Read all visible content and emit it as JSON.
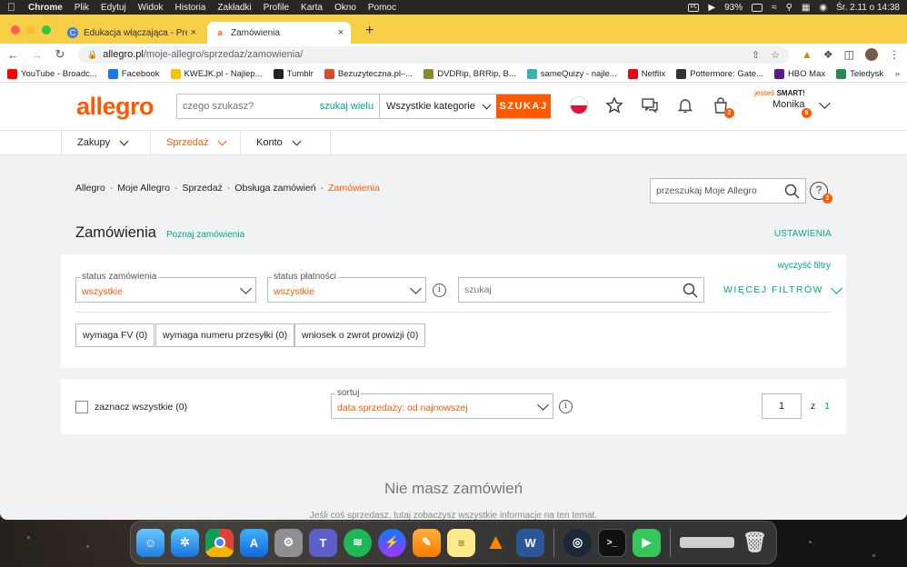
{
  "menubar": {
    "app": "Chrome",
    "items": [
      "Plik",
      "Edytuj",
      "Widok",
      "Historia",
      "Zakładki",
      "Profile",
      "Karta",
      "Okno",
      "Pomoc"
    ],
    "battery": "93%",
    "clock": "Śr. 2.11 o 14:38"
  },
  "browser": {
    "tabs": [
      {
        "title": "Edukacja włączająca - Prezent",
        "active": false
      },
      {
        "title": "Zamówienia",
        "active": true
      }
    ],
    "url_host": "allegro.pl",
    "url_path": "/moje-allegro/sprzedaz/zamowienia/",
    "bookmarks": [
      {
        "label": "YouTube - Broadc...",
        "color": "#ff0000"
      },
      {
        "label": "Facebook",
        "color": "#1877f2"
      },
      {
        "label": "KWEJK.pl - Najlep...",
        "color": "#f5c400"
      },
      {
        "label": "Tumblr",
        "color": "#222222"
      },
      {
        "label": "Bezuzyteczna.pl–...",
        "color": "#d84a2a"
      },
      {
        "label": "DVDRip, BRRip, B...",
        "color": "#8a8a2a"
      },
      {
        "label": "sameQuizy - najle...",
        "color": "#3ab0b0"
      },
      {
        "label": "Netflix",
        "color": "#e50914"
      },
      {
        "label": "Pottermore: Gate...",
        "color": "#333333"
      },
      {
        "label": "HBO Max",
        "color": "#5a1a8a"
      },
      {
        "label": "Teledysk",
        "color": "#2a8a4a"
      }
    ],
    "bookmarks_more": "»"
  },
  "allegro": {
    "logo": "allegro",
    "search_placeholder": "czego szukasz?",
    "search_multi": "szukaj wielu",
    "search_category": "Wszystkie kategorie",
    "search_button": "SZUKAJ",
    "cart_badge": "2",
    "smart_prefix": "jesteś",
    "smart_label": "SMART!",
    "user_name": "Monika",
    "user_badge": "6",
    "nav": [
      "Zakupy",
      "Sprzedaż",
      "Konto"
    ],
    "breadcrumbs": [
      "Allegro",
      "Moje Allegro",
      "Sprzedaż",
      "Obsługa zamówień",
      "Zamówienia"
    ],
    "my_search_placeholder": "przeszukaj Moje Allegro",
    "help_badge": "2",
    "page_title": "Zamówienia",
    "learn_link": "Poznaj zamówienia",
    "settings_link": "USTAWIENIA",
    "clear_filters": "wyczyść filtry",
    "order_status_label": "status zamówienia",
    "order_status_value": "wszystkie",
    "payment_status_label": "status płatności",
    "payment_status_value": "wszystkie",
    "filter_search_placeholder": "szukaj",
    "more_filters": "WIĘCEJ FILTRÓW",
    "chips": [
      "wymaga FV (0)",
      "wymaga numeru przesyłki (0)",
      "wniosek o zwrot prowizji (0)"
    ],
    "select_all": "zaznacz wszystkie (0)",
    "sort_label": "sortuj",
    "sort_value": "data sprzedaży: od najnowszej",
    "page_current": "1",
    "page_of": "z",
    "page_total": "1",
    "empty_title": "Nie masz zamówień",
    "empty_text": "Jeśli coś sprzedasz, tutaj zobaczysz wszystkie informacje na ten temat."
  },
  "colors": {
    "brand": "#ff5a00",
    "link": "#00a790",
    "tabbar": "#f6cf47"
  }
}
